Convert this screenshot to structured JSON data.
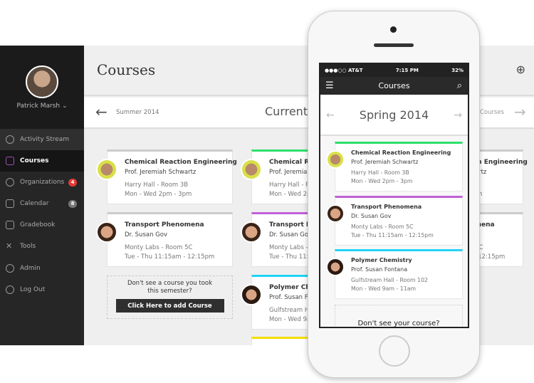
{
  "user": {
    "name": "Patrick Marsh"
  },
  "sidebar": {
    "items": [
      {
        "label": "Activity Stream",
        "icon": "globe-icon"
      },
      {
        "label": "Courses",
        "icon": "courses-icon",
        "active": true
      },
      {
        "label": "Organizations",
        "icon": "organizations-icon",
        "badge": "4",
        "badge_color": "#e53935"
      },
      {
        "label": "Calendar",
        "icon": "calendar-icon",
        "badge": "8",
        "badge_color": "#777777"
      },
      {
        "label": "Gradebook",
        "icon": "gradebook-icon"
      },
      {
        "label": "Tools",
        "icon": "tools-icon"
      },
      {
        "label": "Admin",
        "icon": "admin-icon"
      },
      {
        "label": "Log Out",
        "icon": "logout-icon"
      }
    ]
  },
  "header": {
    "title": "Courses"
  },
  "term_nav": {
    "prev": "Summer 2014",
    "current": "Current",
    "next": "Courses"
  },
  "courses": [
    {
      "title": "Chemical Reaction Engineering",
      "prof": "Prof. Jeremiah Schwartz",
      "location": "Harry Hall - Room 3B",
      "time": "Mon - Wed 2pm - 3pm",
      "color": "#2ee06a"
    },
    {
      "title": "Transport Phenomena",
      "prof": "Dr. Susan Gov",
      "location": "Monty Labs - Room 5C",
      "time": "Tue - Thu 11:15am - 12:15pm",
      "color": "#c060d8"
    },
    {
      "title": "Polymer Chemistry",
      "prof": "Prof. Susan Fontana",
      "location": "Gulfstream Hall - Room 102",
      "time": "Mon - Wed 9am - 11am",
      "color": "#22d3f5"
    }
  ],
  "add_course": {
    "prompt": "Don't see a course you took this semester?",
    "button": "Click Here to add Course"
  },
  "phone": {
    "carrier": "●●●○○ AT&T",
    "time": "7:15 PM",
    "battery": "32%",
    "title": "Courses",
    "term": "Spring 2014",
    "missing_prompt": "Don't see your course?"
  },
  "colors": {
    "accent_purple": "#a24fb8",
    "yellow": "#f5dd00"
  }
}
